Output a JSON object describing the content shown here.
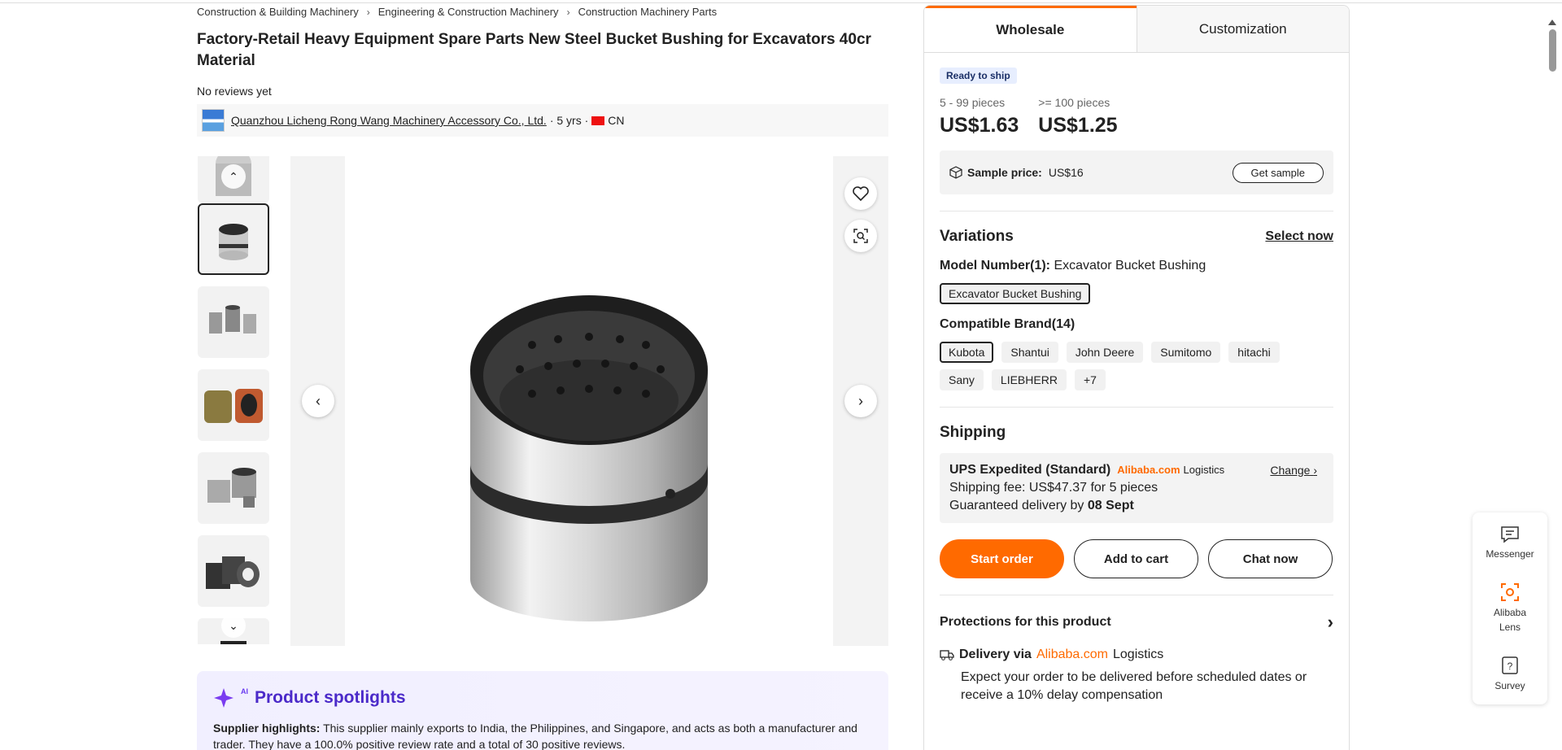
{
  "breadcrumb": [
    "Construction & Building Machinery",
    "Engineering & Construction Machinery",
    "Construction Machinery Parts"
  ],
  "product": {
    "title": "Factory-Retail Heavy Equipment Spare Parts New Steel Bucket Bushing for Excavators 40cr Material",
    "reviews": "No reviews yet"
  },
  "supplier": {
    "name": "Quanzhou Licheng Rong Wang Machinery Accessory Co., Ltd.",
    "years": " · 5 yrs · ",
    "country": "CN"
  },
  "gallery": {
    "thumb_count": 7,
    "active_index": 1
  },
  "spotlights": {
    "title": "Product spotlights",
    "ai_label": "AI",
    "highlight_label": "Supplier highlights:",
    "highlight_text": " This supplier mainly exports to India, the Philippines, and Singapore, and acts as both a manufacturer and trader. They have a 100.0% positive review rate and a total of 30 positive reviews."
  },
  "panel": {
    "tabs": [
      "Wholesale",
      "Customization"
    ],
    "badge": "Ready to ship",
    "tiers": [
      {
        "qty": "5 - 99 pieces",
        "price": "US$1.63"
      },
      {
        "qty": ">= 100 pieces",
        "price": "US$1.25"
      }
    ],
    "sample": {
      "label": "Sample price:",
      "price": "US$16",
      "button": "Get sample"
    },
    "variations": {
      "title": "Variations",
      "select": "Select now",
      "model_label": "Model Number(1):",
      "model_value": " Excavator Bucket Bushing",
      "model_chip": "Excavator Bucket Bushing",
      "brand_label": "Compatible Brand(14)",
      "brands": [
        "Kubota",
        "Shantui",
        "John Deere",
        "Sumitomo",
        "hitachi",
        "Sany",
        "LIEBHERR",
        "+7"
      ]
    },
    "shipping": {
      "title": "Shipping",
      "method": "UPS Expedited (Standard)",
      "brand": "Alibaba.com",
      "logistics": "Logistics",
      "change": "Change",
      "fee": "Shipping fee: US$47.37 for 5 pieces",
      "guarantee_prefix": "Guaranteed delivery by ",
      "guarantee_date": "08 Sept"
    },
    "actions": [
      "Start order",
      "Add to cart",
      "Chat now"
    ],
    "protections": "Protections for this product",
    "delivery": {
      "label": "Delivery via",
      "brand": "Alibaba.com",
      "logistics": "Logistics",
      "text": "Expect your order to be delivered before scheduled dates or receive a 10% delay compensation"
    }
  },
  "floatbar": [
    "Messenger",
    "Alibaba Lens",
    "Survey"
  ],
  "colors": {
    "accent": "#ff6a00",
    "spotlight": "#4b2ac9",
    "badge_bg": "#e7eefe"
  }
}
